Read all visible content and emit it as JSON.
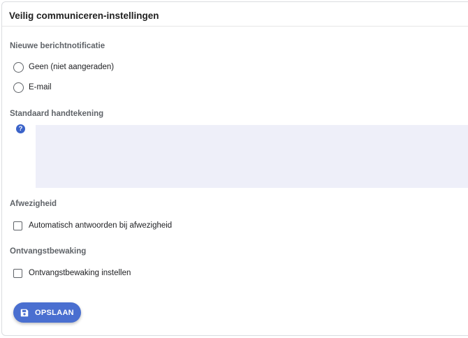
{
  "card": {
    "title": "Veilig communiceren-instellingen"
  },
  "notification": {
    "label": "Nieuwe berichtnotificatie",
    "options": [
      {
        "label": "Geen (niet aangeraden)",
        "selected": false
      },
      {
        "label": "E-mail",
        "selected": false
      }
    ]
  },
  "signature": {
    "label": "Standaard handtekening",
    "value": "",
    "help_icon": "question-circle-icon"
  },
  "absence": {
    "label": "Afwezigheid",
    "checkbox_label": "Automatisch antwoorden bij afwezigheid",
    "checked": false
  },
  "receipt": {
    "label": "Ontvangstbewaking",
    "checkbox_label": "Ontvangstbewaking instellen",
    "checked": false
  },
  "save_button": {
    "label": "OPSLAAN",
    "icon": "save-icon",
    "color": "#4a6fd0"
  }
}
